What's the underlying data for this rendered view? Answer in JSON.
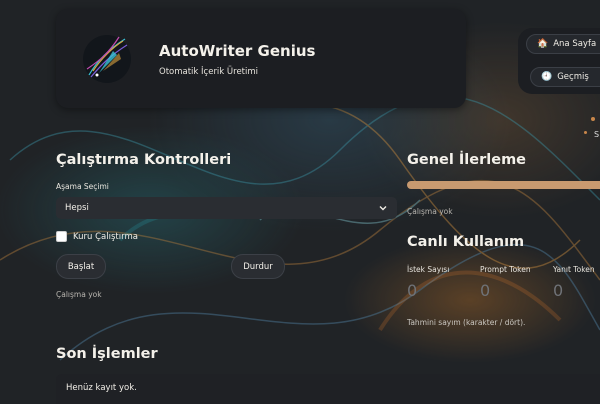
{
  "app": {
    "title": "AutoWriter Genius",
    "subtitle": "Otomatik İçerik Üretimi",
    "logo_icon": "quill-pen-logo-icon"
  },
  "nav": {
    "home": {
      "icon": "house-icon",
      "glyph": "🏠",
      "label": "Ana Sayfa"
    },
    "history": {
      "icon": "clock-icon",
      "glyph": "🕘",
      "label": "Geçmiş"
    },
    "edge_text": "S"
  },
  "controls": {
    "title": "Çalıştırma Kontrolleri",
    "stage_label": "Aşama Seçimi",
    "stage_selected": "Hepsi",
    "dry_run_label": "Kuru Çalıştırma",
    "dry_run_checked": false,
    "start_label": "Başlat",
    "stop_label": "Durdur",
    "status": "Çalışma yok"
  },
  "progress": {
    "title": "Genel İlerleme",
    "value_percent": 100,
    "status": "Çalışma yok"
  },
  "usage": {
    "title": "Canlı Kullanım",
    "metrics": [
      {
        "label": "İstek Sayısı",
        "value": "0"
      },
      {
        "label": "Prompt Token",
        "value": "0"
      },
      {
        "label": "Yanıt Token",
        "value": "0"
      }
    ],
    "note": "Tahmini sayım (karakter / dört)."
  },
  "recent": {
    "title": "Son İşlemler",
    "empty_text": "Henüz kayıt yok."
  },
  "colors": {
    "accent": "#c89a70",
    "card": "#1c1e22",
    "background": "#202326"
  }
}
